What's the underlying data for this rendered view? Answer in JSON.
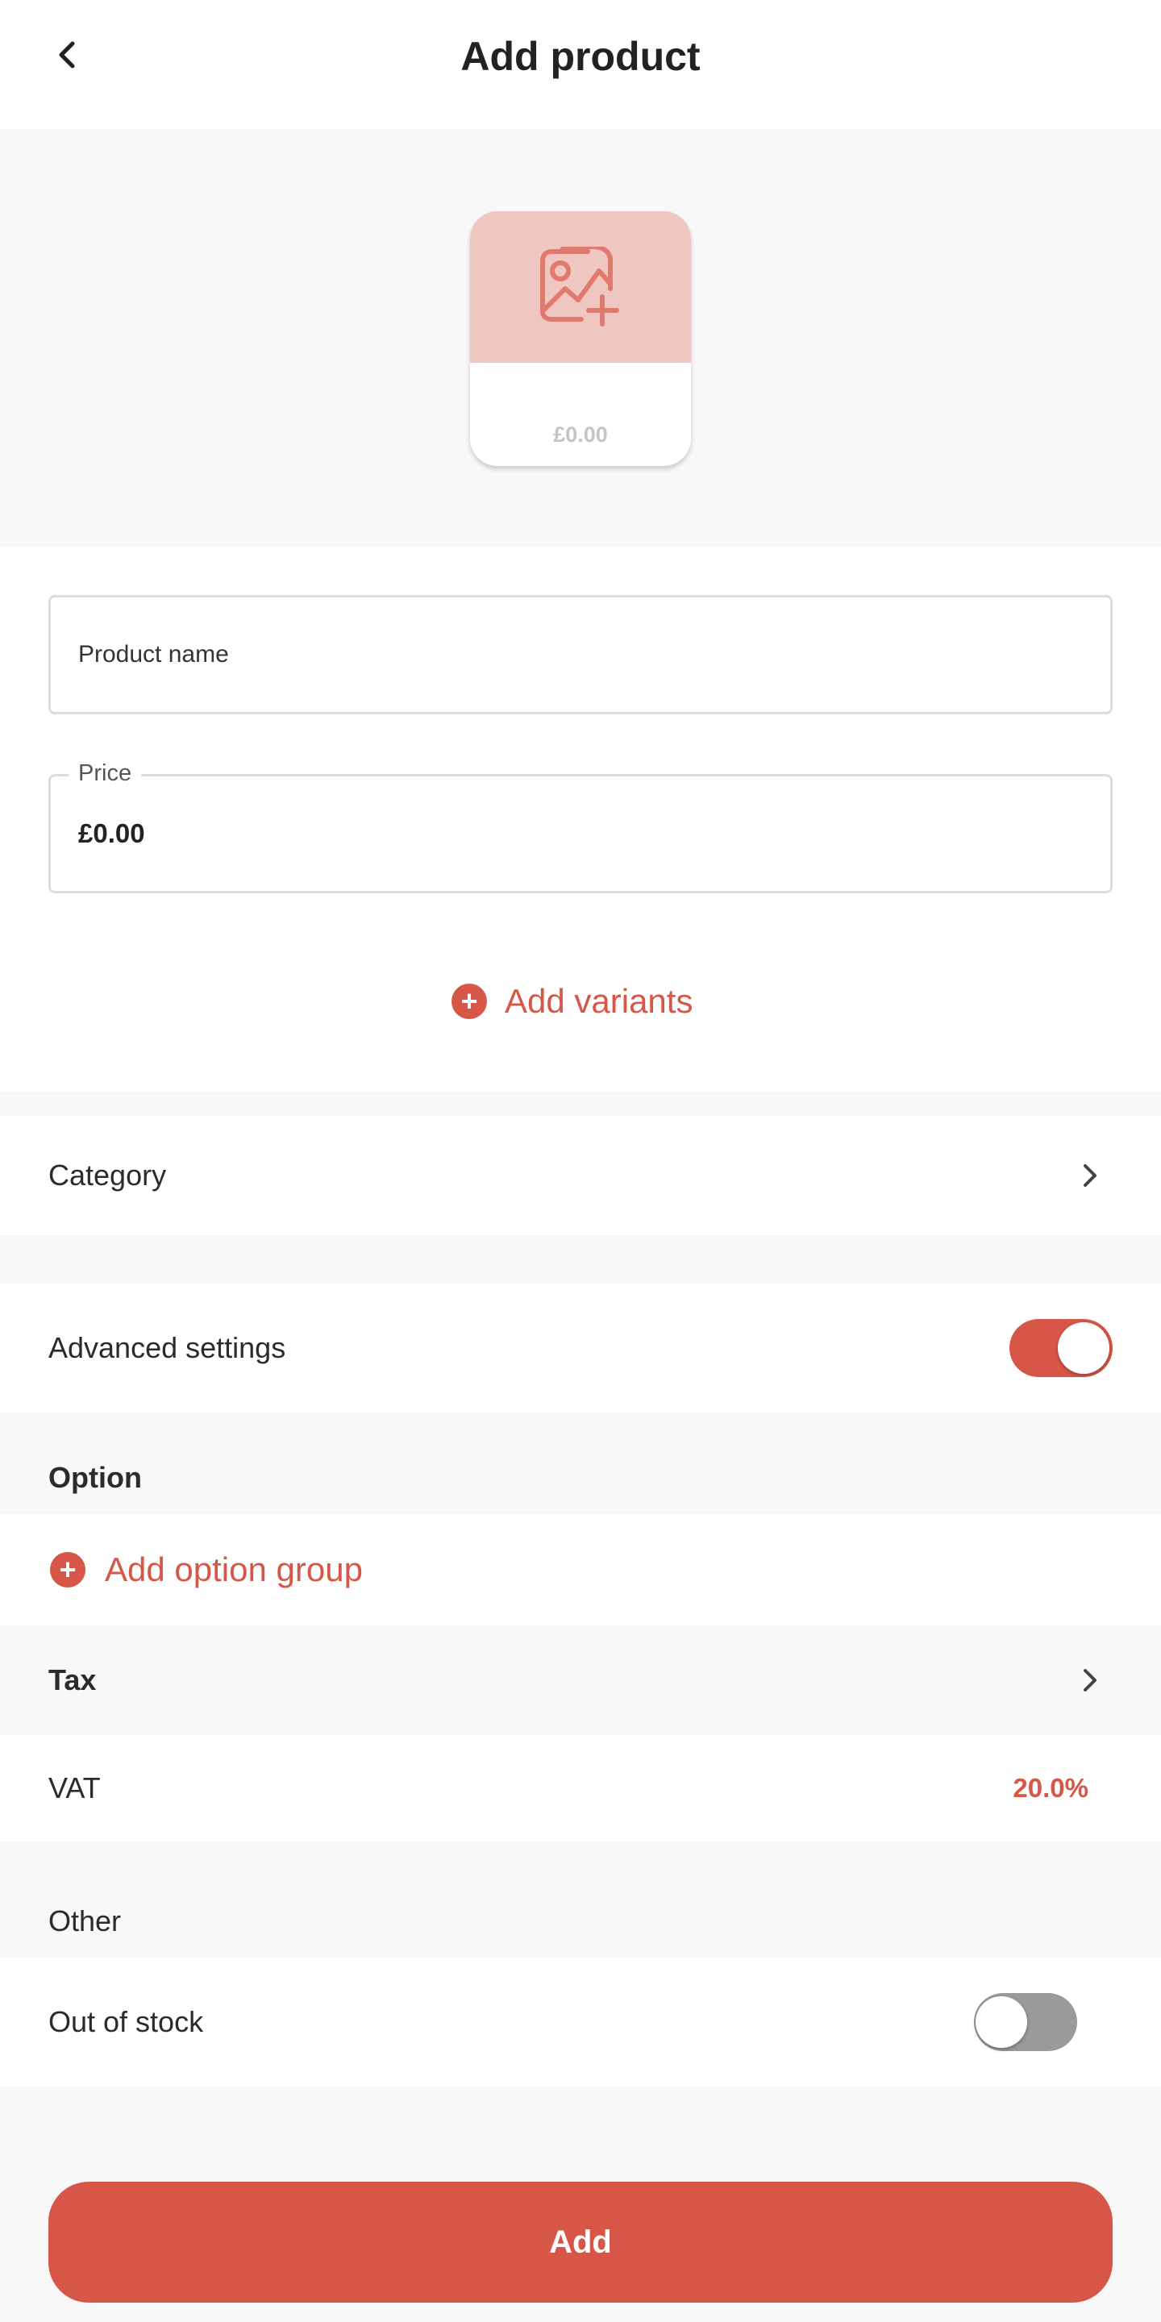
{
  "header": {
    "title": "Add product",
    "back_icon": "chevron-left-icon"
  },
  "image_card": {
    "icon": "add-image-icon",
    "price": "£0.00"
  },
  "form": {
    "product_name": {
      "placeholder": "Product name",
      "value": ""
    },
    "price": {
      "label": "Price",
      "value": "£0.00"
    },
    "add_variants_label": "Add variants"
  },
  "category": {
    "label": "Category"
  },
  "advanced_settings": {
    "label": "Advanced settings",
    "enabled": true
  },
  "option": {
    "title": "Option",
    "add_group_label": "Add option group"
  },
  "tax": {
    "title": "Tax",
    "vat_label": "VAT",
    "vat_value": "20.0%"
  },
  "other": {
    "title": "Other",
    "out_of_stock_label": "Out of stock",
    "out_of_stock_enabled": false
  },
  "footer": {
    "add_button_label": "Add"
  },
  "colors": {
    "accent": "#d65748",
    "image_placeholder_bg": "#f0c6c1",
    "background": "#f8f8f8"
  }
}
